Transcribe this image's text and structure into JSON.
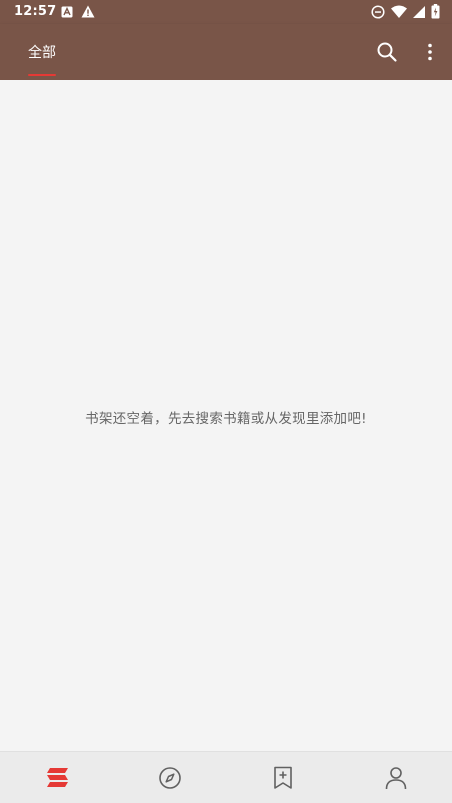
{
  "status_bar": {
    "time": "12:57",
    "left_icons": [
      "app-notification-icon",
      "warning-icon"
    ],
    "right_icons": [
      "do-not-disturb-icon",
      "wifi-icon",
      "signal-icon",
      "battery-icon"
    ]
  },
  "app_bar": {
    "tabs": [
      {
        "label": "全部",
        "selected": true
      }
    ],
    "actions": [
      "search-icon",
      "more-vert-icon"
    ],
    "background": "#795548",
    "indicator_color": "#e53935"
  },
  "main": {
    "empty_message": "书架还空着，先去搜索书籍或从发现里添加吧!"
  },
  "bottom_nav": {
    "items": [
      {
        "icon": "bookshelf-icon",
        "active": true
      },
      {
        "icon": "compass-icon",
        "active": false
      },
      {
        "icon": "bookmark-add-icon",
        "active": false
      },
      {
        "icon": "person-icon",
        "active": false
      }
    ],
    "active_color": "#e53935",
    "inactive_color": "#616161"
  }
}
